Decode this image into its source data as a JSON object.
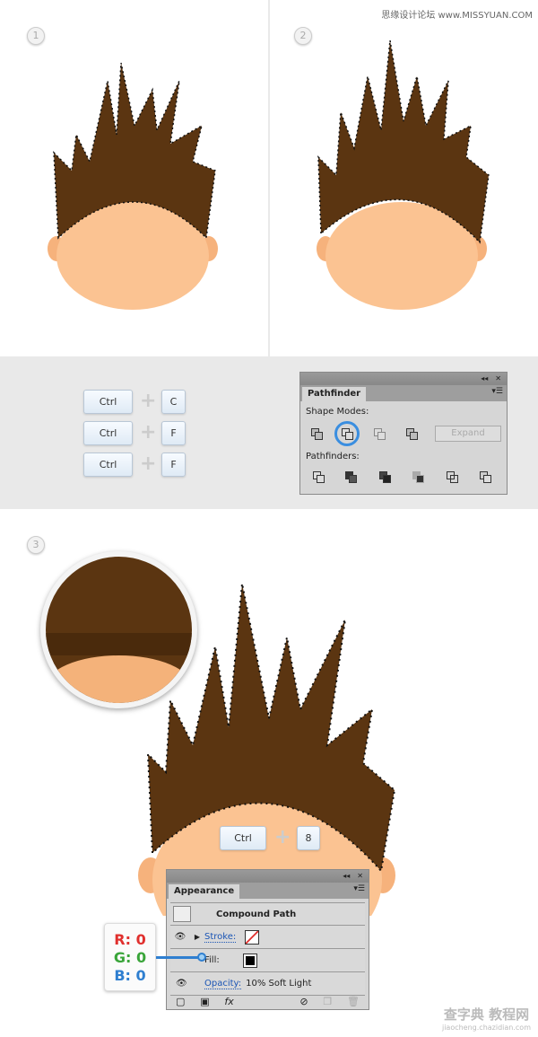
{
  "watermark_top": "思缘设计论坛 www.MISSYUAN.COM",
  "watermark_bottom": "查字典 教程网",
  "watermark_bottom_url": "jiaocheng.chazidian.com",
  "steps": [
    "1",
    "2",
    "3"
  ],
  "shortcuts": [
    {
      "mod": "Ctrl",
      "key": "C"
    },
    {
      "mod": "Ctrl",
      "key": "F"
    },
    {
      "mod": "Ctrl",
      "key": "F"
    }
  ],
  "step3_shortcut": {
    "mod": "Ctrl",
    "key": "8"
  },
  "pathfinder": {
    "tab": "Pathfinder",
    "shape_modes": "Shape Modes:",
    "expand": "Expand",
    "pathfinders": "Pathfinders:",
    "selected_mode": "Minus Front"
  },
  "appearance": {
    "tab": "Appearance",
    "title": "Compound Path",
    "stroke": "Stroke:",
    "fill": "Fill:",
    "opacity": "Opacity:",
    "opacity_value": "10% Soft Light"
  },
  "rgb": {
    "r": "R: 0",
    "g": "G: 0",
    "b": "B: 0"
  },
  "colors": {
    "hair": "#5b3511",
    "skin": "#fbc392",
    "r": "#e0302e",
    "g": "#3aa53a",
    "b": "#2f7fd0"
  }
}
